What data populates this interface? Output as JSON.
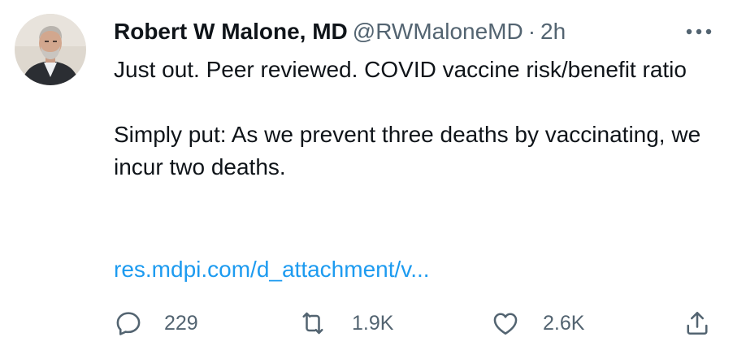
{
  "author": {
    "display_name": "Robert W Malone, MD",
    "handle": "@RWMaloneMD",
    "separator": "·",
    "timestamp": "2h",
    "avatar_icon": "profile-photo"
  },
  "more_icon": "more-horizontal-icon",
  "tweet": {
    "line1": "Just out.  Peer reviewed.  COVID vaccine risk/benefit ratio",
    "line2": "Simply put: As we prevent three deaths by vaccinating, we incur two deaths.",
    "link_text": "res.mdpi.com/d_attachment/v..."
  },
  "actions": {
    "reply": {
      "icon": "reply-icon",
      "count": "229"
    },
    "retweet": {
      "icon": "retweet-icon",
      "count": "1.9K"
    },
    "like": {
      "icon": "heart-icon",
      "count": "2.6K"
    },
    "share": {
      "icon": "share-icon"
    }
  },
  "colors": {
    "text": "#0f1419",
    "secondary": "#536471",
    "link": "#1d9bf0",
    "background": "#ffffff"
  }
}
